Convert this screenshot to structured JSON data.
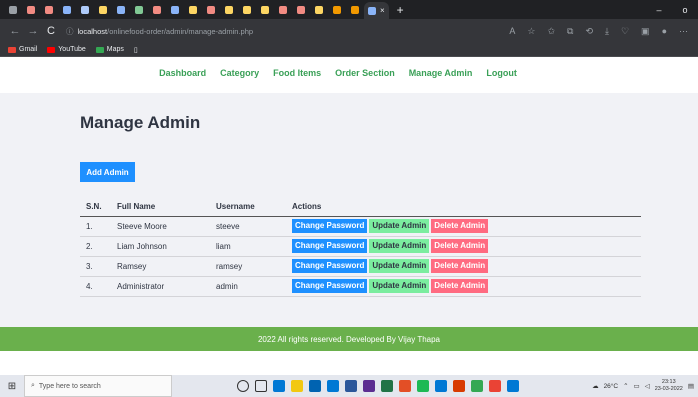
{
  "browser": {
    "active_tab_close": "×",
    "new_tab": "+",
    "window_controls": [
      "–",
      "o"
    ],
    "nav": {
      "back": "←",
      "forward": "→",
      "reload": "C"
    },
    "url_host": "localhost",
    "url_path": "/onlinefood-order/admin/manage-admin.php",
    "bookmarks": [
      {
        "label": "Gmail",
        "color": "#ea4335"
      },
      {
        "label": "YouTube",
        "color": "#ff0000"
      },
      {
        "label": "Maps",
        "color": "#34a853"
      }
    ]
  },
  "menu": [
    "Dashboard",
    "Category",
    "Food Items",
    "Order Section",
    "Manage Admin",
    "Logout"
  ],
  "page_title": "Manage Admin",
  "add_button": "Add Admin",
  "table": {
    "headers": [
      "S.N.",
      "Full Name",
      "Username",
      "Actions"
    ],
    "rows": [
      {
        "sn": "1.",
        "full_name": "Steeve Moore",
        "username": "steeve"
      },
      {
        "sn": "2.",
        "full_name": "Liam Johnson",
        "username": "liam"
      },
      {
        "sn": "3.",
        "full_name": "Ramsey",
        "username": "ramsey"
      },
      {
        "sn": "4.",
        "full_name": "Administrator",
        "username": "admin"
      }
    ],
    "actions": {
      "change_password": "Change Password",
      "update": "Update Admin",
      "delete": "Delete Admin"
    }
  },
  "footer": "2022 All rights reserved. Developed By Vijay Thapa",
  "taskbar": {
    "search_placeholder": "Type here to search",
    "weather": "26°C",
    "time": "23:13",
    "date": "23-03-2022"
  },
  "colors": {
    "primary": "#1e90ff",
    "update": "#7bed9f",
    "delete": "#ff6b81",
    "footer": "#6ab04c",
    "menu": "#3aa057"
  }
}
